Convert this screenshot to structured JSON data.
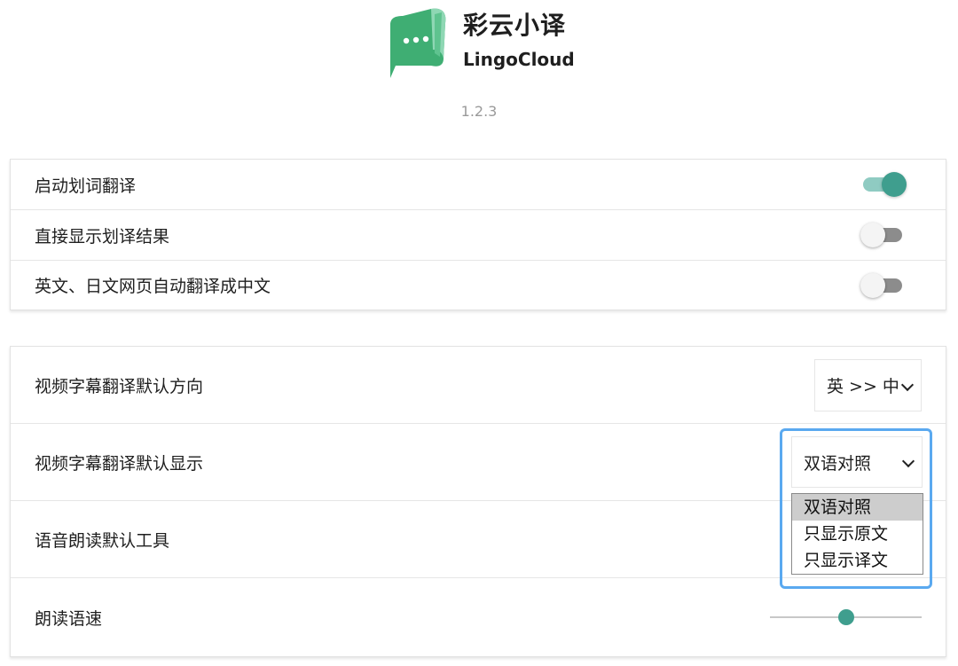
{
  "header": {
    "app_name_cn": "彩云小译",
    "app_name_en": "LingoCloud",
    "version": "1.2.3",
    "logo_icon": "speech-bubble-logo-icon",
    "logo_color": "#3fae73"
  },
  "settings_general": [
    {
      "label": "启动划词翻译",
      "enabled": true
    },
    {
      "label": "直接显示划译结果",
      "enabled": false
    },
    {
      "label": "英文、日文网页自动翻译成中文",
      "enabled": false
    }
  ],
  "settings_video": {
    "direction": {
      "label": "视频字幕翻译默认方向",
      "value": "英 >> 中"
    },
    "display": {
      "label": "视频字幕翻译默认显示",
      "value": "双语对照",
      "options": [
        "双语对照",
        "只显示原文",
        "只显示译文"
      ],
      "highlighted_option": "双语对照"
    },
    "voice_tool": {
      "label": "语音朗读默认工具"
    },
    "speed": {
      "label": "朗读语速",
      "value": 0.5
    }
  },
  "colors": {
    "accent": "#3f9e8e",
    "accent_light": "#8fcbc2",
    "focus_ring": "#5aa9f0"
  }
}
